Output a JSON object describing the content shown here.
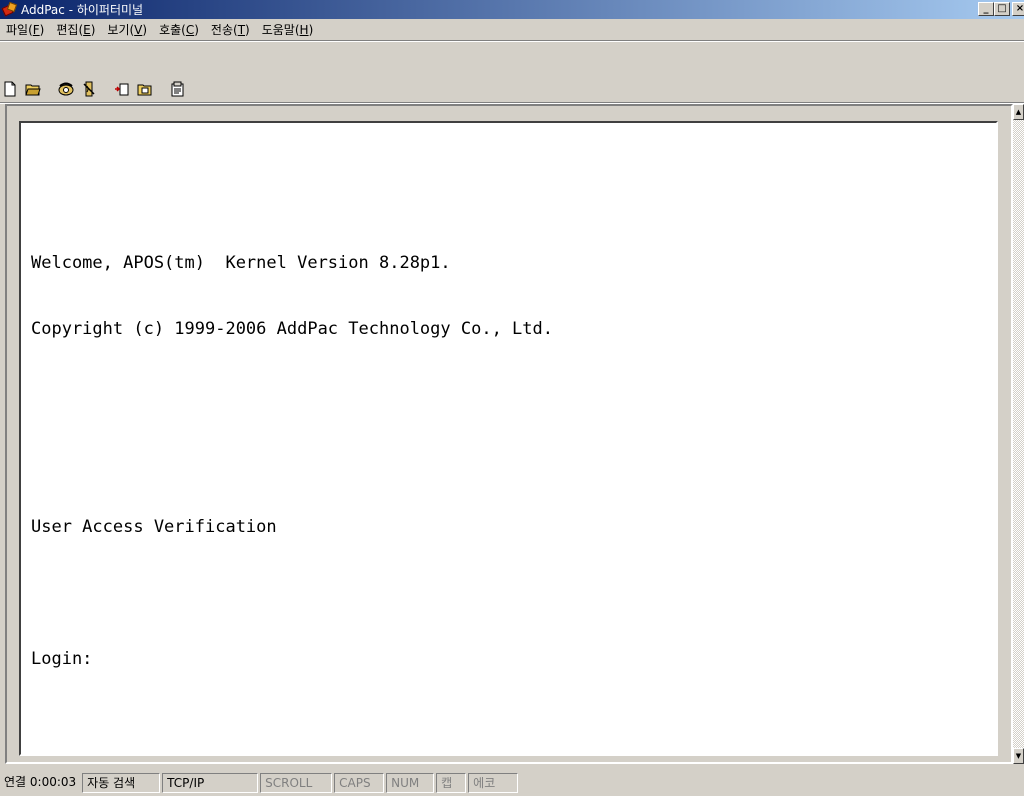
{
  "window": {
    "title": "AddPac - 하이퍼터미널",
    "minimize_label": "_",
    "maximize_label": "□",
    "close_label": "×"
  },
  "menu": [
    {
      "label": "파일(",
      "acc": "F",
      "suffix": ")"
    },
    {
      "label": "편집(",
      "acc": "E",
      "suffix": ")"
    },
    {
      "label": "보기(",
      "acc": "V",
      "suffix": ")"
    },
    {
      "label": "호출(",
      "acc": "C",
      "suffix": ")"
    },
    {
      "label": "전송(",
      "acc": "T",
      "suffix": ")"
    },
    {
      "label": "도움말(",
      "acc": "H",
      "suffix": ")"
    }
  ],
  "toolbar": {
    "icons": [
      "new-document-icon",
      "open-folder-icon",
      "connect-phone-icon",
      "disconnect-icon",
      "send-file-icon",
      "receive-file-icon",
      "properties-icon"
    ]
  },
  "terminal": {
    "lines": [
      "Welcome, APOS(tm)  Kernel Version 8.28p1.",
      "Copyright (c) 1999-2006 AddPac Technology Co., Ltd.",
      "",
      "",
      "User Access Verification",
      "",
      "Login:"
    ]
  },
  "status": {
    "connection_time": "연결 0:00:03",
    "auto_detect": "자동 검색",
    "protocol": "TCP/IP",
    "scroll": "SCROLL",
    "caps": "CAPS",
    "num": "NUM",
    "capture": "캡",
    "echo": "에코"
  }
}
